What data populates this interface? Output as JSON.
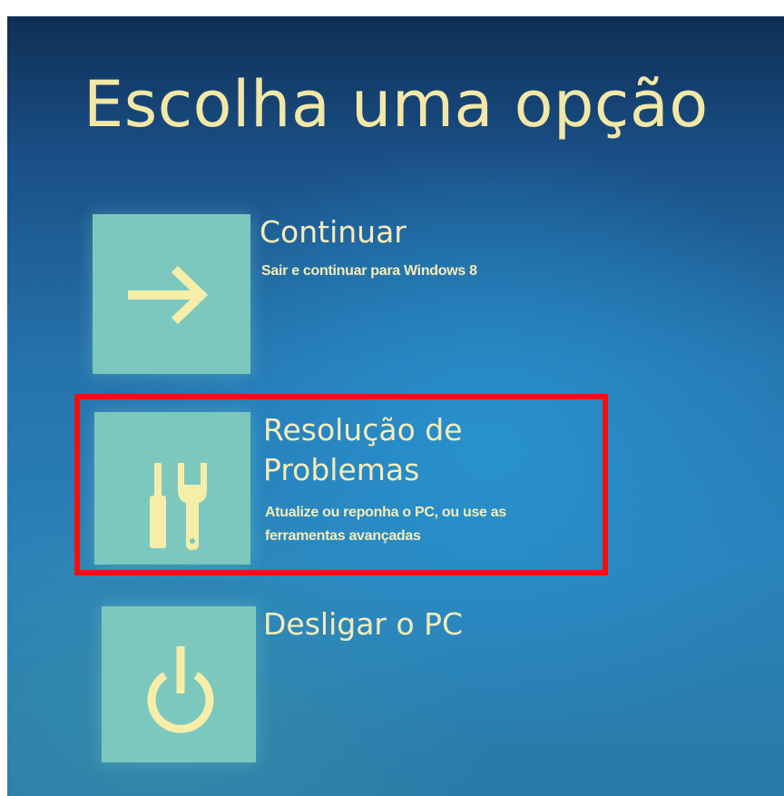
{
  "page": {
    "title": "Escolha uma opção"
  },
  "options": [
    {
      "title": "Continuar",
      "description": "Sair e continuar para Windows 8",
      "icon": "arrow-right-icon"
    },
    {
      "title_line1": "Resolução de",
      "title_line2": "Problemas",
      "description_line1": "Atualize ou reponha o PC, ou use as",
      "description_line2": "ferramentas avançadas",
      "icon": "tools-icon",
      "highlighted": true
    },
    {
      "title": "Desligar o PC",
      "icon": "power-icon"
    }
  ],
  "colors": {
    "tile": "#7cc8bf",
    "text": "#f4ecb8",
    "icon": "#f6eea8",
    "highlight_border": "#ee1111"
  }
}
